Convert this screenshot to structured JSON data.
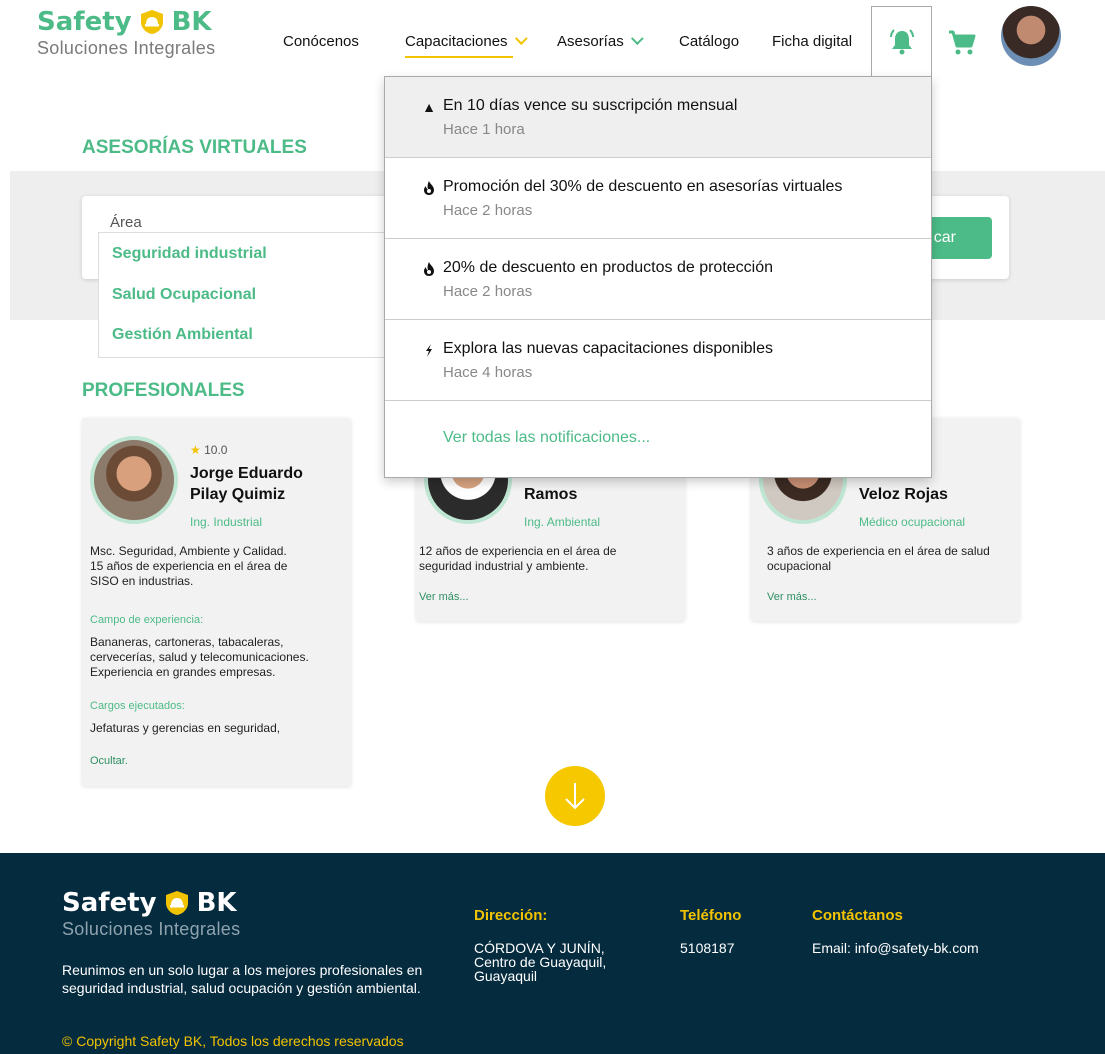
{
  "brand": {
    "name_left": "Safety",
    "name_right": "BK",
    "tagline": "Soluciones Integrales"
  },
  "nav": {
    "items": [
      "Conócenos",
      "Capacitaciones",
      "Asesorías",
      "Catálogo",
      "Ficha digital"
    ]
  },
  "colors": {
    "accent": "#4cbb87",
    "yellow": "#f2c300",
    "footer": "#052b3f",
    "band": "#eeeeee"
  },
  "icons": {
    "bell": "bell-icon",
    "cart": "cart-icon",
    "arrow": "arrow-down-icon"
  },
  "asesorias": {
    "title": "ASESORÍAS VIRTUALES",
    "area_label": "Área",
    "area_options": [
      "Seguridad industrial",
      "Salud Ocupacional",
      "Gestión Ambiental"
    ],
    "search_button": "car"
  },
  "profesionales": {
    "title": "PROFESIONALES",
    "cards": [
      {
        "rating": "10.0",
        "name_line1": "Jorge Eduardo",
        "name_line2": "Pilay Quimiz",
        "title": "Ing. Industrial",
        "desc": [
          "Msc. Seguridad, Ambiente y Calidad.",
          "15 años de experiencia en el área de",
          "SISO en industrias."
        ],
        "campo_label": "Campo de experiencia:",
        "campo": [
          "Bananeras, cartoneras, tabacaleras,",
          "cervecerías, salud y telecomunicaciones.",
          "Experiencia en grandes empresas."
        ],
        "cargos_label": "Cargos ejecutados:",
        "cargos": "Jefaturas y gerencias en seguridad,",
        "link": "Ocultar."
      },
      {
        "name_line2": "Ramos",
        "title": "Ing. Ambiental",
        "desc": [
          "12 años de experiencia en el área de",
          "seguridad industrial y ambiente."
        ],
        "link": "Ver más..."
      },
      {
        "name_line2": "Veloz Rojas",
        "title": "Médico ocupacional",
        "desc": [
          "3 años de experiencia en el área de salud",
          "ocupacional"
        ],
        "link": "Ver más..."
      }
    ]
  },
  "notifications": {
    "items": [
      {
        "icon": "warning-icon",
        "glyph": "▲",
        "text": "En 10 días vence su suscripción mensual",
        "time": "Hace 1 hora"
      },
      {
        "icon": "fire-icon",
        "glyph": "ʚ",
        "text": "Promoción del 30% de descuento en asesorías virtuales",
        "time": "Hace 2 horas"
      },
      {
        "icon": "fire-icon",
        "glyph": "ʚ",
        "text": "20% de descuento en productos de protección",
        "time": "Hace 2 horas"
      },
      {
        "icon": "bolt-icon",
        "glyph": "ϟ",
        "text": "Explora las nuevas capacitaciones disponibles",
        "time": "Hace 4 horas"
      }
    ],
    "view_all": "Ver todas las notificaciones..."
  },
  "footer": {
    "description": "Reunimos en un solo lugar a los mejores profesionales en seguridad industrial, salud ocupación y gestión ambiental.",
    "copyright": "© Copyright Safety BK,  Todos los derechos reservados",
    "address_title": "Dirección:",
    "address_lines": [
      "CÓRDOVA Y JUNÍN,",
      "Centro de Guayaquil,",
      "Guayaquil"
    ],
    "phone_title": "Teléfono",
    "phone": "5108187",
    "contact_title": "Contáctanos",
    "email": "Email: info@safety-bk.com"
  }
}
